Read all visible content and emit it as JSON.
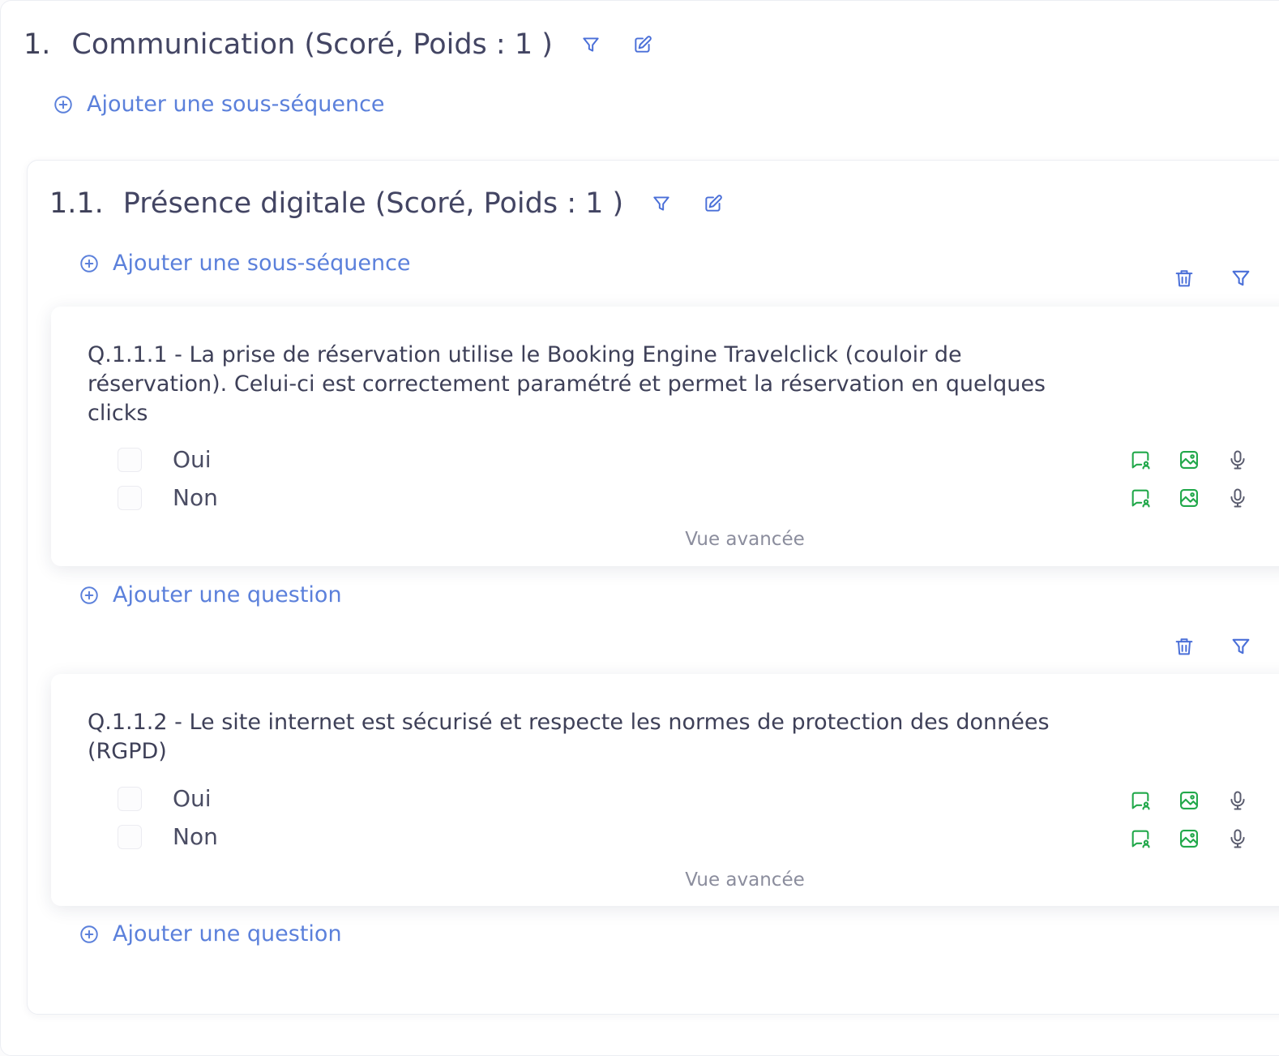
{
  "section": {
    "number": "1.",
    "title": "Communication (Scoré, Poids : 1 )",
    "icons": [
      "filter-icon",
      "edit-icon"
    ],
    "add_subsequence_label": "Ajouter une sous-séquence"
  },
  "subsection": {
    "number": "1.1.",
    "title": "Présence digitale (Scoré, Poids : 1 )",
    "icons": [
      "filter-icon",
      "edit-icon"
    ],
    "add_subsequence_label": "Ajouter une sous-séquence",
    "question_tool_icons": [
      "trash-icon",
      "filter-icon"
    ],
    "questions": [
      {
        "text": "Q.1.1.1 - La prise de réservation utilise le Booking Engine Travelclick (couloir de réservation). Celui-ci est correctement paramétré et permet la réservation en quelques clicks",
        "options": [
          {
            "label": "Oui",
            "checked": false
          },
          {
            "label": "Non",
            "checked": false
          }
        ],
        "advanced_view_label": "Vue avancée",
        "add_question_label": "Ajouter une question"
      },
      {
        "text": "Q.1.1.2 - Le site internet est sécurisé et respecte les normes de protection des données (RGPD)",
        "options": [
          {
            "label": "Oui",
            "checked": false
          },
          {
            "label": "Non",
            "checked": false
          }
        ],
        "advanced_view_label": "Vue avancée",
        "add_question_label": "Ajouter une question"
      }
    ]
  },
  "option_action_icons": [
    "comment-user-icon",
    "image-icon",
    "microphone-icon"
  ],
  "colors": {
    "link": "#5b80db",
    "heading": "#434563",
    "icon_blue": "#4a6fd8",
    "icon_green": "#21a84a",
    "icon_gray": "#5a5c6e"
  }
}
